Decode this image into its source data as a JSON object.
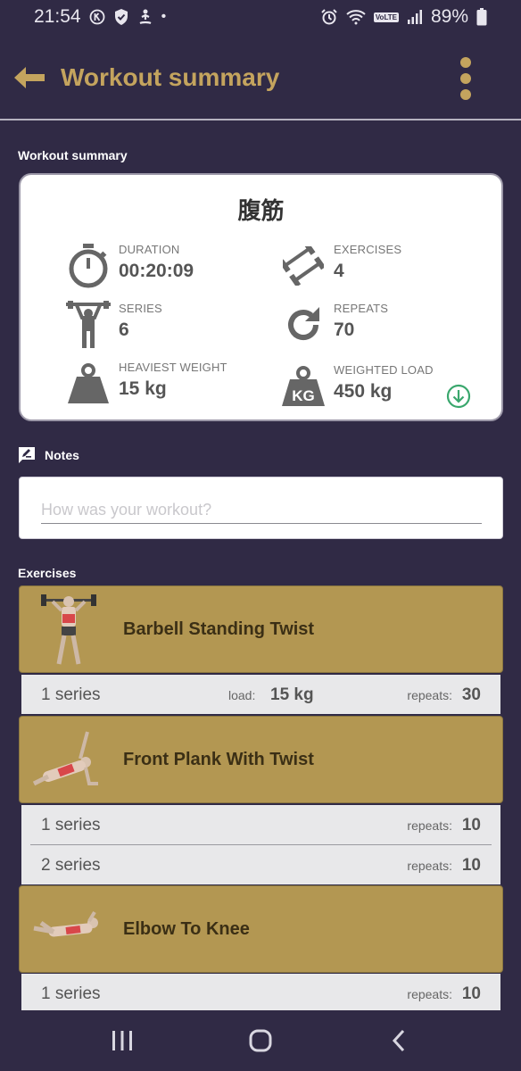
{
  "status_bar": {
    "time": "21:54",
    "dot": "•",
    "battery": "89%",
    "lte_badge": "VoLTE",
    "icons": [
      "k-badge-icon",
      "shield-icon",
      "yoga-icon",
      "alarm-icon",
      "wifi-icon",
      "signal-icon",
      "battery-icon"
    ]
  },
  "app_bar": {
    "title": "Workout summary",
    "accent": "#c4a45e"
  },
  "summary": {
    "section_label": "Workout summary",
    "title": "腹筋",
    "stats": {
      "duration": {
        "label": "DURATION",
        "value": "00:20:09",
        "icon": "stopwatch-icon"
      },
      "exercises": {
        "label": "EXERCISES",
        "value": "4",
        "icon": "dumbbells-icon"
      },
      "series": {
        "label": "SERIES",
        "value": "6",
        "icon": "weightlifter-icon"
      },
      "repeats": {
        "label": "REPEATS",
        "value": "70",
        "icon": "repeat-icon"
      },
      "heaviest_weight": {
        "label": "HEAVIEST WEIGHT",
        "value": "15 kg",
        "icon": "weight-icon"
      },
      "weighted_load": {
        "label": "WEIGHTED LOAD",
        "value": "450 kg",
        "icon": "kg-weight-icon"
      }
    }
  },
  "notes": {
    "label": "Notes",
    "placeholder": "How was your workout?"
  },
  "exercises": {
    "label": "Exercises",
    "items": [
      {
        "name": "Barbell Standing Twist",
        "rows": [
          {
            "series": "1 series",
            "load_label": "load:",
            "load": "15 kg",
            "repeats_label": "repeats:",
            "repeats": "30"
          }
        ]
      },
      {
        "name": "Front Plank With Twist",
        "rows": [
          {
            "series": "1 series",
            "repeats_label": "repeats:",
            "repeats": "10"
          },
          {
            "series": "2 series",
            "repeats_label": "repeats:",
            "repeats": "10"
          }
        ]
      },
      {
        "name": "Elbow To Knee",
        "rows": [
          {
            "series": "1 series",
            "repeats_label": "repeats:",
            "repeats": "10"
          }
        ]
      }
    ]
  },
  "nav": [
    "recent-apps-icon",
    "home-icon",
    "back-icon"
  ]
}
